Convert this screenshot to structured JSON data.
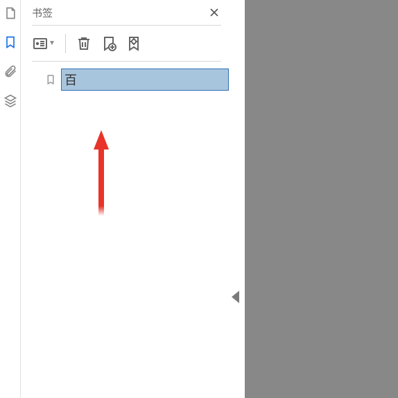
{
  "panel": {
    "title": "书签"
  },
  "bookmark": {
    "editing_value": "百"
  },
  "icons": {
    "pages": "pages",
    "bookmarks": "bookmarks",
    "attachments": "attachments",
    "layers": "layers"
  }
}
